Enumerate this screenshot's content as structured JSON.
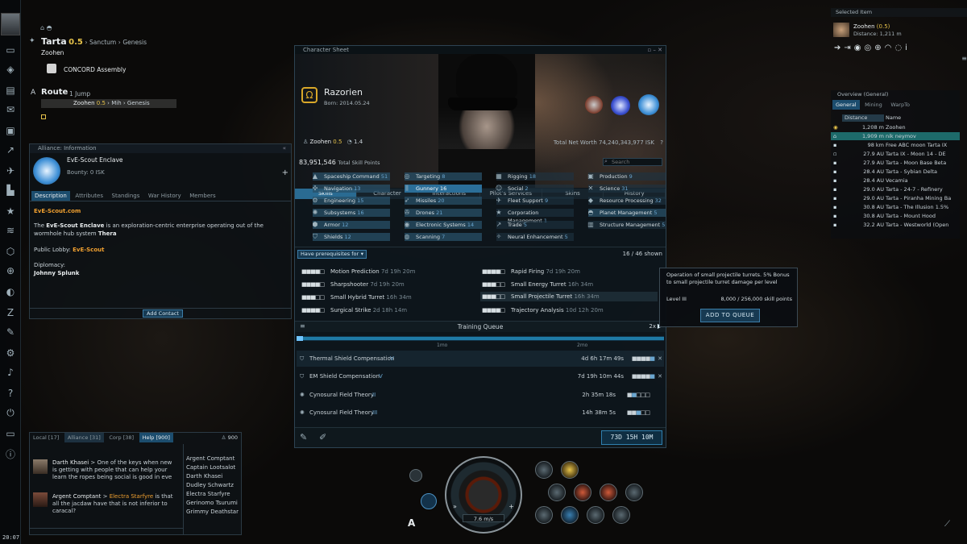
{
  "clock": "20:07",
  "location": {
    "system": "Tarta",
    "security": "0.5",
    "constellation": "Sanctum",
    "region": "Genesis",
    "station_owner": "Zoohen",
    "station": "CONCORD Assembly",
    "route_label": "Route",
    "jumps": "1 Jump",
    "route_from": "Zoohen",
    "route_sec": "0.5",
    "route_to": "Mih",
    "route_region": "Genesis"
  },
  "alliance": {
    "window_title": "Alliance: Information",
    "name": "EvE-Scout Enclave",
    "bounty": "Bounty: 0 ISK",
    "tabs": [
      "Description",
      "Attributes",
      "Standings",
      "War History",
      "Members"
    ],
    "link": "EvE-Scout.com",
    "desc_pre": "The ",
    "desc_name": "EvE-Scout Enclave",
    "desc_post": " is an exploration-centric enterprise operating out of the wormhole hub system ",
    "desc_system": "Thera",
    "lobby_label": "Public Lobby: ",
    "lobby_name": "EvE-Scout",
    "diplomacy_label": "Diplomacy:",
    "diplomat": "Johnny Splunk",
    "add_contact": "Add Contact"
  },
  "character_sheet": {
    "window_title": "Character Sheet",
    "name": "Razorien",
    "born": "Born: 2014.05.24",
    "location": "Zoohen",
    "security": "0.5",
    "jumps": "1.4",
    "net_worth": "Total Net Worth 74,240,343,977 ISK",
    "tabs": [
      "Skills",
      "Character",
      "Interactions",
      "Pilot's Services",
      "Skins",
      "History"
    ],
    "total_sp": "83,951,546",
    "total_sp_label": "Total Skill Points",
    "search_placeholder": "Search",
    "categories": [
      {
        "label": "Spaceship Command",
        "count": "51"
      },
      {
        "label": "Targeting",
        "count": "8"
      },
      {
        "label": "Rigging",
        "count": "18"
      },
      {
        "label": "Production",
        "count": "9"
      },
      {
        "label": "Navigation",
        "count": "13"
      },
      {
        "label": "Gunnery",
        "count": "16"
      },
      {
        "label": "Social",
        "count": "2"
      },
      {
        "label": "Science",
        "count": "31"
      },
      {
        "label": "Engineering",
        "count": "15"
      },
      {
        "label": "Missiles",
        "count": "20"
      },
      {
        "label": "Fleet Support",
        "count": "9"
      },
      {
        "label": "Resource Processing",
        "count": "32"
      },
      {
        "label": "Subsystems",
        "count": "16"
      },
      {
        "label": "Drones",
        "count": "21"
      },
      {
        "label": "Corporation Management",
        "count": "1"
      },
      {
        "label": "Planet Management",
        "count": "5"
      },
      {
        "label": "Armor",
        "count": "12"
      },
      {
        "label": "Electronic Systems",
        "count": "14"
      },
      {
        "label": "Trade",
        "count": "5"
      },
      {
        "label": "Structure Management",
        "count": "5"
      },
      {
        "label": "Shields",
        "count": "12"
      },
      {
        "label": "Scanning",
        "count": "7"
      },
      {
        "label": "Neural Enhancement",
        "count": "5"
      }
    ],
    "filter": "Have prerequisites for",
    "shown": "16 / 46 shown",
    "skills": [
      {
        "name": "Motion Prediction",
        "time": "7d 19h 20m"
      },
      {
        "name": "Rapid Firing",
        "time": "7d 19h 20m"
      },
      {
        "name": "Sharpshooter",
        "time": "7d 19h 20m"
      },
      {
        "name": "Small Energy Turret",
        "time": "16h 34m"
      },
      {
        "name": "Small Hybrid Turret",
        "time": "16h 34m"
      },
      {
        "name": "Small Projectile Turret",
        "time": "16h 34m"
      },
      {
        "name": "Surgical Strike",
        "time": "2d 18h 14m"
      },
      {
        "name": "Trajectory Analysis",
        "time": "10d 12h 20m"
      }
    ],
    "training_queue": "Training Queue",
    "tq_speed": "2x",
    "tq_marks": [
      "1mo",
      "2mo"
    ],
    "queue": [
      {
        "name": "Thermal Shield Compensation",
        "level": "V",
        "time": "4d 6h 17m 49s"
      },
      {
        "name": "EM Shield Compensation",
        "level": "V",
        "time": "7d 19h 10m 44s"
      },
      {
        "name": "Cynosural Field Theory",
        "level": "II",
        "time": "2h 35m 18s"
      },
      {
        "name": "Cynosural Field Theory",
        "level": "III",
        "time": "14h 38m 5s"
      }
    ],
    "total_time": "73D 15H 10M"
  },
  "tooltip": {
    "text": "Operation of small projectile turrets. 5% Bonus to small projectile turret damage per level",
    "level": "Level III",
    "sp": "8,000 / 256,000 skill points",
    "button": "ADD TO QUEUE"
  },
  "selected_item": {
    "title": "Selected Item",
    "name": "Zoohen",
    "sec": "(0.5)",
    "distance": "Distance: 1,211 m"
  },
  "overview": {
    "title": "Overview (General)",
    "tabs": [
      "General",
      "Mining",
      "WarpTo"
    ],
    "col_distance": "Distance",
    "col_name": "Name",
    "rows": [
      {
        "distance": "1,208 m",
        "name": "Zoohen"
      },
      {
        "distance": "1,909 m",
        "name": "nik neymov"
      },
      {
        "distance": "98 km",
        "name": "Free ABC moon Tarta IX"
      },
      {
        "distance": "27.9 AU",
        "name": "Tarta IX - Moon 14 - DE"
      },
      {
        "distance": "27.9 AU",
        "name": "Tarta - Moon Base Beta"
      },
      {
        "distance": "28.4 AU",
        "name": "Tarta - Sybian Delta"
      },
      {
        "distance": "28.4 AU",
        "name": "Vecamia"
      },
      {
        "distance": "29.0 AU",
        "name": "Tarta - 24-7 - Refinery"
      },
      {
        "distance": "29.0 AU",
        "name": "Tarta - Piranha Mining Ba"
      },
      {
        "distance": "30.8 AU",
        "name": "Tarta - The Illusion 1.5%"
      },
      {
        "distance": "30.8 AU",
        "name": "Tarta - Mount Hood"
      },
      {
        "distance": "32.2 AU",
        "name": "Tarta - Westworld (Open"
      }
    ]
  },
  "chat": {
    "tabs": [
      "Local [17]",
      "Alliance [31]",
      "Corp [38]",
      "Help [900]"
    ],
    "member_count": "900",
    "messages": [
      {
        "author": "Darth Khasei",
        "text": "One of the keys when new is getting with people that can help your learn the ropes being social is good in eve"
      },
      {
        "author": "Argent Comptant",
        "target": "Electra Starfyre",
        "text": "is that all the jacdaw have that is not inferior to caracal?"
      }
    ],
    "members": [
      "Argent Comptant",
      "Captain Lootsalot",
      "Darth Khasei",
      "Dudley Schwartz",
      "Electra Starfyre",
      "Gerinomo Tsurumi",
      "Grimmy Deathstar"
    ]
  },
  "hud": {
    "speed": "7.6 m/s"
  }
}
